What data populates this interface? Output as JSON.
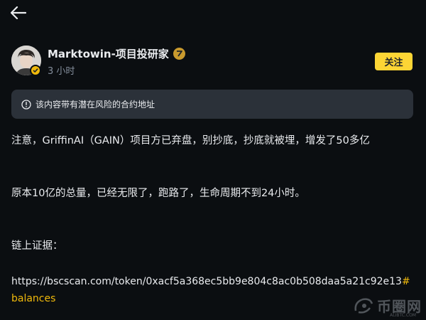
{
  "nav": {
    "back_icon": "arrow-left-icon"
  },
  "author": {
    "name": "Marktowin-项目投研家",
    "time": "3 小时",
    "badge_icon": "creator-badge-icon",
    "verified_icon": "verified-check-icon",
    "follow_label": "关注"
  },
  "warning": {
    "icon": "info-circle-icon",
    "text": "该内容带有潜在风险的合约地址"
  },
  "post": {
    "line1": "注意，GriffinAI（GAIN）项目方已弃盘，别抄底，抄底就被埋，增发了50多亿",
    "line2": "原本10亿的总量，已经无限了，跑路了，生命周期不到24小时。",
    "line3": "链上证据：",
    "link_text": "https://bscscan.com/token/0xacf5a368ec5bb9e804c8ac0b508daa5a21c92e13",
    "hashtag": "#balances"
  },
  "watermark": {
    "text": "币圈网",
    "sub": "ALIBTC.COM"
  },
  "colors": {
    "background": "#0b0e11",
    "accent": "#fcd535",
    "hashtag": "#f0b90b",
    "card": "#2b3139",
    "muted": "#848e9c"
  }
}
